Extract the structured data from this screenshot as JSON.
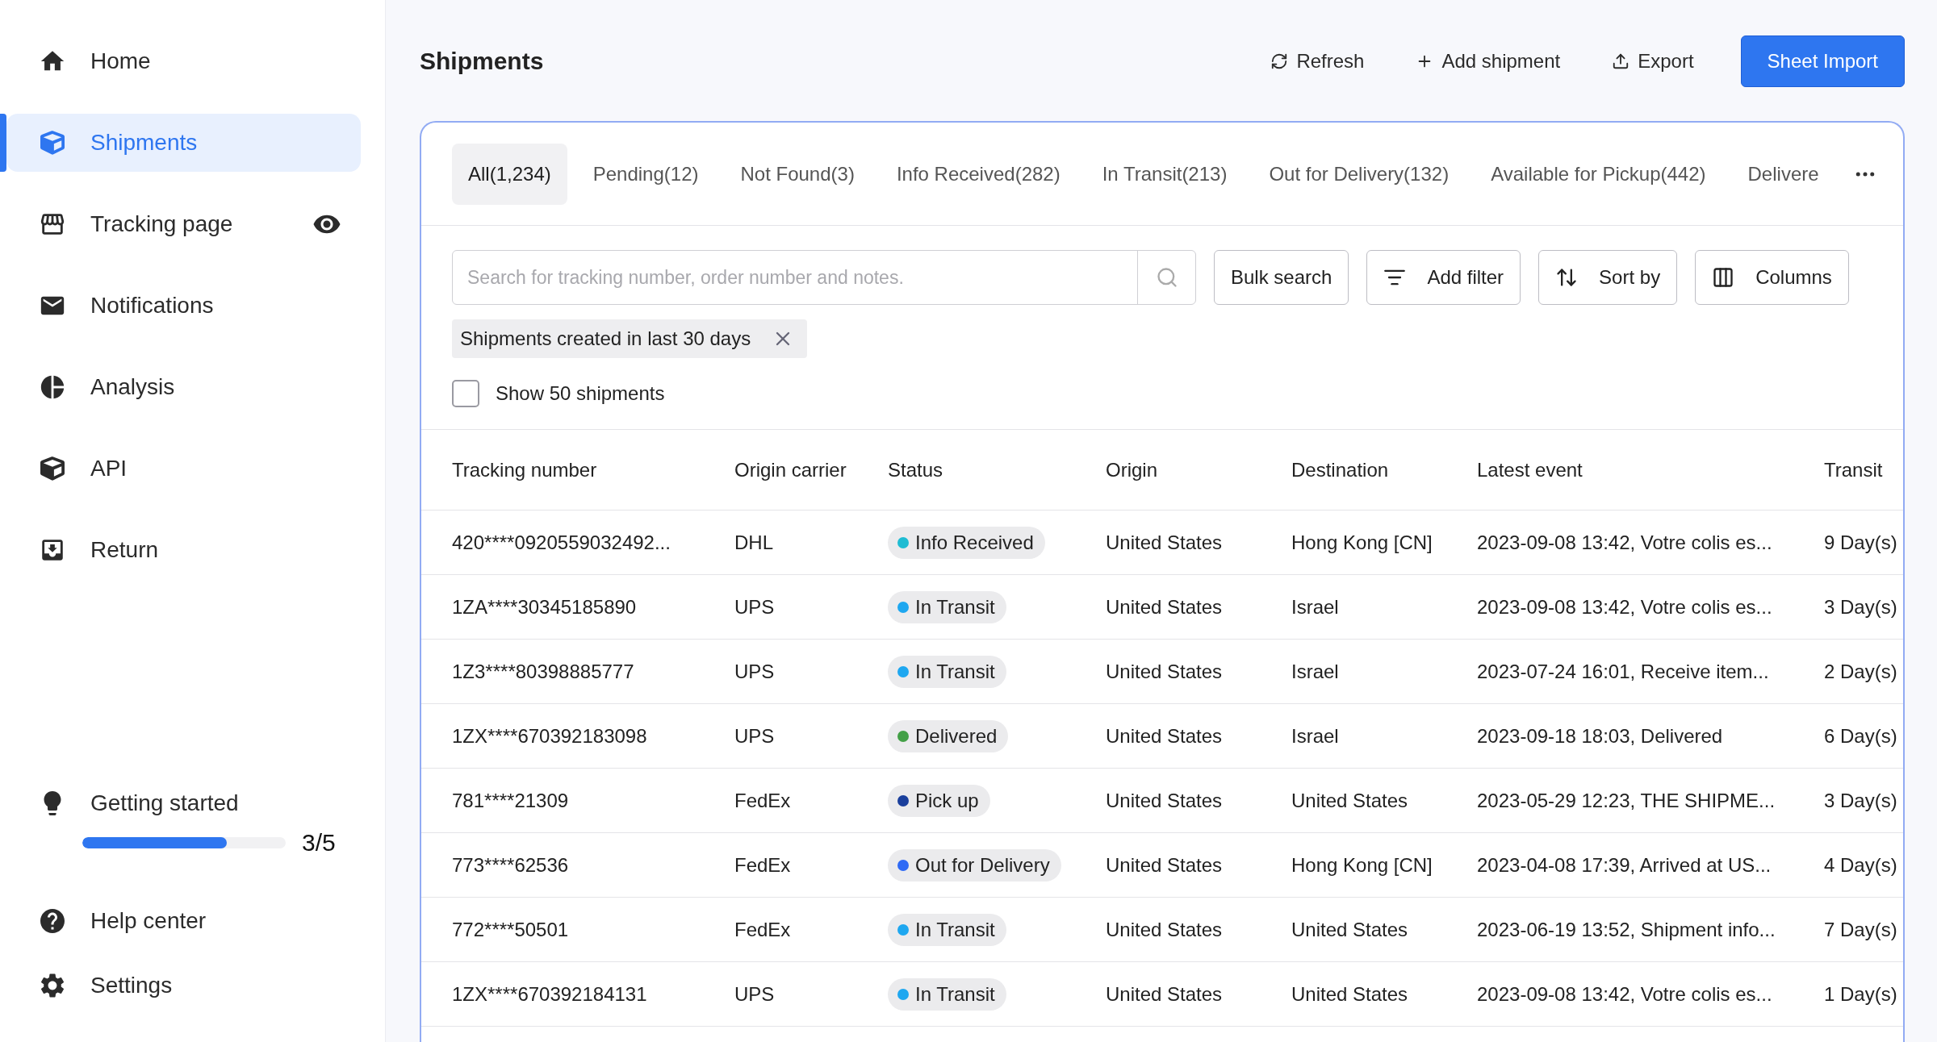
{
  "sidebar": {
    "items": [
      {
        "label": "Home",
        "selected": false
      },
      {
        "label": "Shipments",
        "selected": true
      },
      {
        "label": "Tracking page",
        "selected": false
      },
      {
        "label": "Notifications",
        "selected": false
      },
      {
        "label": "Analysis",
        "selected": false
      },
      {
        "label": "API",
        "selected": false
      },
      {
        "label": "Return",
        "selected": false
      }
    ],
    "getting_started": {
      "label": "Getting started",
      "level": 0.71,
      "progress": "3/5"
    },
    "footer_items": [
      {
        "label": "Help center"
      },
      {
        "label": "Settings"
      }
    ]
  },
  "header": {
    "title": "Shipments",
    "actions": [
      "Refresh",
      "Add shipment",
      "Export"
    ],
    "primary": "Sheet Import"
  },
  "tabs": [
    {
      "label": "All(1,234)",
      "selected": true
    },
    {
      "label": "Pending(12)",
      "selected": false
    },
    {
      "label": "Not Found(3)",
      "selected": false
    },
    {
      "label": "Info Received(282)",
      "selected": false
    },
    {
      "label": "In Transit(213)",
      "selected": false
    },
    {
      "label": "Out for Delivery(132)",
      "selected": false
    },
    {
      "label": "Available for Pickup(442)",
      "selected": false
    },
    {
      "label": "Delivere",
      "selected": false
    }
  ],
  "search": {
    "placeholder": "Search for tracking number, order number and notes."
  },
  "toolbar": [
    "Bulk search",
    "Add filter",
    "Sort by",
    "Columns"
  ],
  "filter_chip": "Shipments created in last 30 days",
  "show_all": {
    "label": "Show 50 shipments",
    "checked": false
  },
  "table": {
    "columns": [
      "Tracking number",
      "Origin carrier",
      "Status",
      "Origin",
      "Destination",
      "Latest event",
      "Transit"
    ],
    "rows": [
      {
        "tracking": "420****0920559032492...",
        "carrier": "DHL",
        "status": "Info Received",
        "color": "#1fbcd3",
        "origin": "United States",
        "destination": "Hong Kong [CN]",
        "event": "2023-09-08 13:42, Votre colis es...",
        "transit": "9 Day(s)"
      },
      {
        "tracking": "1ZA****30345185890",
        "carrier": "UPS",
        "status": "In Transit",
        "color": "#1ea7f0",
        "origin": "United States",
        "destination": "Israel",
        "event": "2023-09-08 13:42, Votre colis es...",
        "transit": "3 Day(s)"
      },
      {
        "tracking": "1Z3****80398885777",
        "carrier": "UPS",
        "status": "In Transit",
        "color": "#1ea7f0",
        "origin": "United States",
        "destination": "Israel",
        "event": "2023-07-24 16:01, Receive item...",
        "transit": "2 Day(s)"
      },
      {
        "tracking": "1ZX****670392183098",
        "carrier": "UPS",
        "status": "Delivered",
        "color": "#43a047",
        "origin": "United States",
        "destination": "Israel",
        "event": "2023-09-18 18:03, Delivered",
        "transit": "6 Day(s)"
      },
      {
        "tracking": "781****21309",
        "carrier": "FedEx",
        "status": "Pick up",
        "color": "#1a3f9c",
        "origin": "United States",
        "destination": "United States",
        "event": "2023-05-29 12:23, THE SHIPME...",
        "transit": "3 Day(s)"
      },
      {
        "tracking": "773****62536",
        "carrier": "FedEx",
        "status": "Out for Delivery",
        "color": "#2f6af5",
        "origin": "United States",
        "destination": "Hong Kong [CN]",
        "event": "2023-04-08 17:39, Arrived at US...",
        "transit": "4 Day(s)"
      },
      {
        "tracking": "772****50501",
        "carrier": "FedEx",
        "status": "In Transit",
        "color": "#1ea7f0",
        "origin": "United States",
        "destination": "United States",
        "event": "2023-06-19 13:52, Shipment info...",
        "transit": "7 Day(s)"
      },
      {
        "tracking": "1ZX****670392184131",
        "carrier": "UPS",
        "status": "In Transit",
        "color": "#1ea7f0",
        "origin": "United States",
        "destination": "United States",
        "event": "2023-09-08 13:42, Votre colis es...",
        "transit": "1 Day(s)"
      }
    ]
  }
}
